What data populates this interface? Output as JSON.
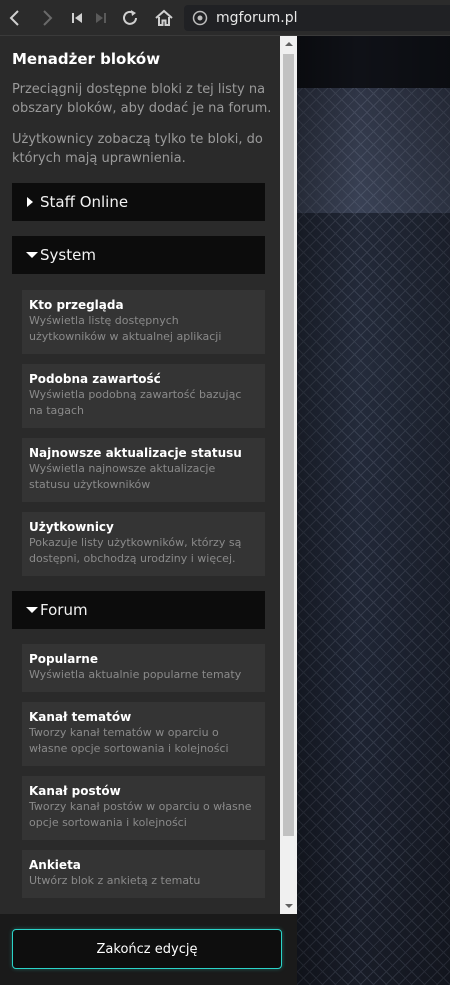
{
  "browser": {
    "url": "mgforum.pl",
    "icons": [
      "back-icon",
      "forward-icon",
      "first-page-icon",
      "disabled-skip-icon",
      "reload-icon",
      "home-icon",
      "site-info-icon"
    ]
  },
  "sidebar": {
    "title": "Menadżer bloków",
    "desc1": "Przeciągnij dostępne bloki z tej listy na obszary bloków, aby dodać je na forum.",
    "desc2": "Użytkownicy zobaczą tylko te bloki, do których mają uprawnienia.",
    "categories": [
      {
        "label": "Staff Online",
        "state": "collapsed"
      },
      {
        "label": "System",
        "state": "expanded"
      },
      {
        "label": "Forum",
        "state": "expanded"
      }
    ],
    "system_blocks": [
      {
        "title": "Kto przegląda",
        "desc": "Wyświetla listę dostępnych użytkowników w aktualnej aplikacji"
      },
      {
        "title": "Podobna zawartość",
        "desc": "Wyświetla podobną zawartość bazując na tagach"
      },
      {
        "title": "Najnowsze aktualizacje statusu",
        "desc": "Wyświetla najnowsze aktualizacje statusu użytkowników"
      },
      {
        "title": "Użytkownicy",
        "desc": "Pokazuje listy użytkowników, którzy są dostępni, obchodzą urodziny i więcej."
      }
    ],
    "forum_blocks": [
      {
        "title": "Popularne",
        "desc": "Wyświetla aktualnie popularne tematy"
      },
      {
        "title": "Kanał tematów",
        "desc": "Tworzy kanał tematów w oparciu o własne opcje sortowania i kolejności"
      },
      {
        "title": "Kanał postów",
        "desc": "Tworzy kanał postów w oparciu o własne opcje sortowania i kolejności"
      },
      {
        "title": "Ankieta",
        "desc": "Utwórz blok z ankietą z tematu"
      }
    ],
    "finish_label": "Zakończ edycję"
  },
  "colors": {
    "accent": "#2bd3c8",
    "panel": "#2a2a2a",
    "category": "#0c0c0c",
    "block": "#343434"
  }
}
